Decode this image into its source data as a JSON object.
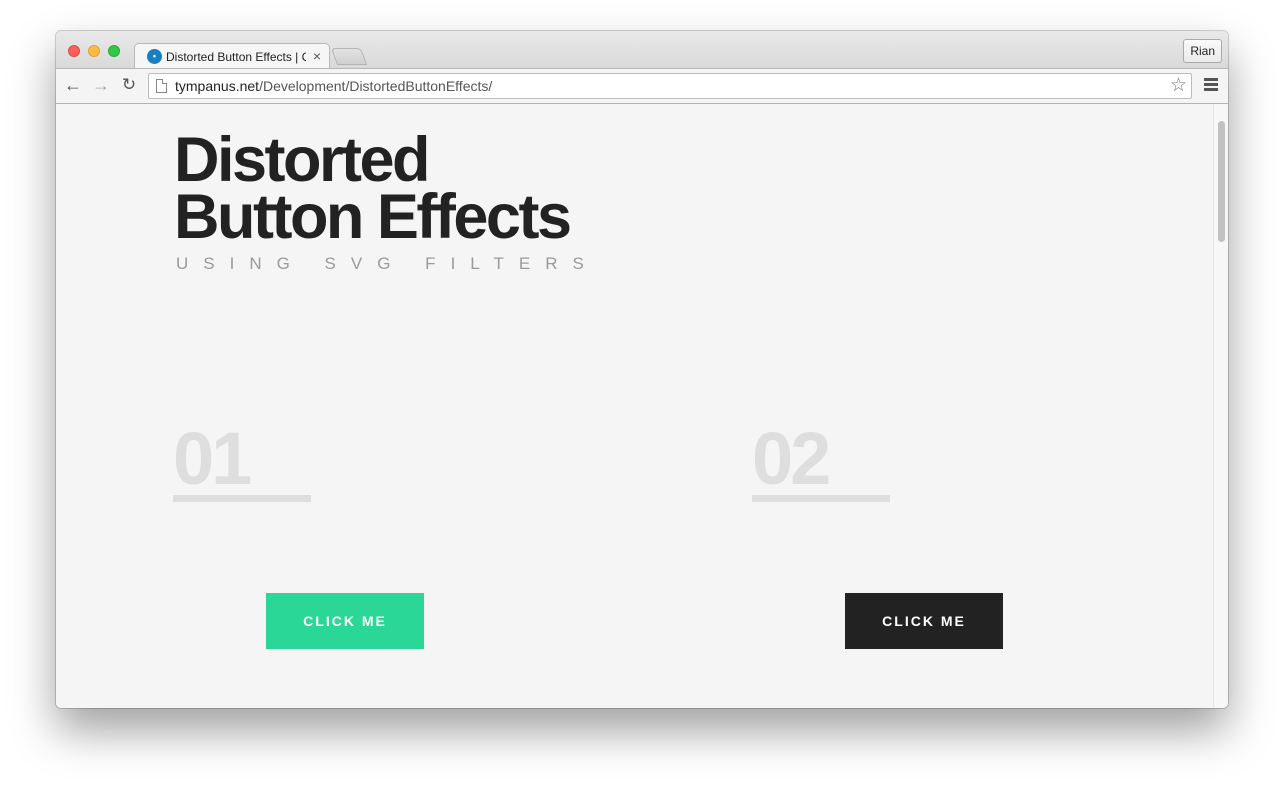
{
  "browser": {
    "tab_title": "Distorted Button Effects | Codrops",
    "tab_close": "×",
    "favicon": "💧",
    "profile_name": "Rian",
    "url_host": "tympanus.net",
    "url_path": "/Development/DistortedButtonEffects/",
    "nav": {
      "back": "←",
      "forward": "→",
      "reload": "↻"
    },
    "star": "☆"
  },
  "page": {
    "title_line1": "Distorted",
    "title_line2": "Button Effects",
    "subtitle": "USING SVG FILTERS",
    "demos": [
      {
        "number": "01",
        "button_label": "CLICK ME",
        "button_color": "#2bd796"
      },
      {
        "number": "02",
        "button_label": "CLICK ME",
        "button_color": "#222222"
      }
    ]
  }
}
